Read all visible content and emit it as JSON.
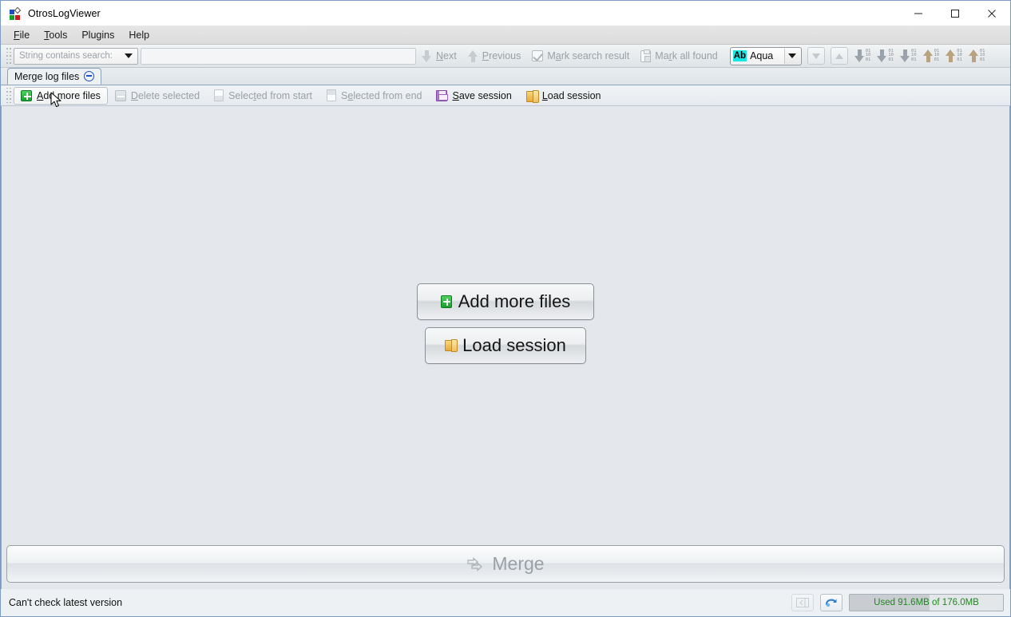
{
  "window": {
    "title": "OtrosLogViewer",
    "icon": "app-logo-icon",
    "controls": {
      "minimize": "minimize-button",
      "maximize": "maximize-button",
      "close": "close-button"
    }
  },
  "menubar": {
    "items": [
      {
        "label": "File",
        "mnemonic": "F"
      },
      {
        "label": "Tools",
        "mnemonic": "T"
      },
      {
        "label": "Plugins",
        "mnemonic": "P"
      },
      {
        "label": "Help",
        "mnemonic": "H"
      }
    ]
  },
  "search_toolbar": {
    "mode_combo": {
      "value": "String contains search:",
      "enabled": false
    },
    "search_input": {
      "value": "",
      "placeholder": ""
    },
    "next_label": "Next",
    "previous_label": "Previous",
    "mark_search_result_label": "Mark search result",
    "mark_search_result_checked": true,
    "mark_all_found_label": "Mark all found",
    "color_combo": {
      "badge": "Ab",
      "value": "Aqua",
      "color": "#16e6e6"
    },
    "nav_buttons": [
      {
        "name": "scroll-down-button"
      },
      {
        "name": "scroll-up-button"
      }
    ],
    "bin_buttons": [
      {
        "name": "jump-down-first-button",
        "bits": [
          "01",
          "10",
          "01"
        ]
      },
      {
        "name": "jump-down-next-button",
        "bits": [
          "01",
          "10",
          "01"
        ]
      },
      {
        "name": "jump-down-last-button",
        "bits": [
          "01",
          "10",
          "01"
        ]
      },
      {
        "name": "jump-up-first-button",
        "bits": [
          "01",
          "10",
          "01"
        ]
      },
      {
        "name": "jump-up-prev-button",
        "bits": [
          "01",
          "10",
          "01"
        ]
      },
      {
        "name": "jump-up-last-button",
        "bits": [
          "01",
          "10",
          "01"
        ]
      }
    ]
  },
  "tabs": [
    {
      "label": "Merge log files",
      "active": true,
      "closable": true
    }
  ],
  "sub_toolbar": {
    "buttons": [
      {
        "label": "Add more files",
        "mnemonic": "A",
        "icon": "plus-icon",
        "enabled": true,
        "hovered": true
      },
      {
        "label": "Delete selected",
        "mnemonic": "D",
        "icon": "minus-icon",
        "enabled": false,
        "hovered": false
      },
      {
        "label": "Selected from start",
        "mnemonic": "t",
        "icon": "document-top-icon",
        "enabled": false,
        "hovered": false
      },
      {
        "label": "Selected from end",
        "mnemonic": "e",
        "icon": "document-bottom-icon",
        "enabled": false,
        "hovered": false
      },
      {
        "label": "Save session",
        "mnemonic": "S",
        "icon": "floppy-icon",
        "enabled": true,
        "hovered": false
      },
      {
        "label": "Load session",
        "mnemonic": "L",
        "icon": "folder-icon",
        "enabled": true,
        "hovered": false
      }
    ]
  },
  "main": {
    "add_more_files_label": "Add more files",
    "load_session_label": "Load session",
    "merge_label": "Merge",
    "merge_enabled": false
  },
  "statusbar": {
    "message": "Can't check latest version",
    "buttons": [
      {
        "name": "toggle-panel-button",
        "enabled": false
      },
      {
        "name": "refresh-button",
        "enabled": true
      }
    ],
    "memory": "Used 91.6MB of 176.0MB",
    "memory_color": "#1a8a1a",
    "memory_percent": 52
  }
}
